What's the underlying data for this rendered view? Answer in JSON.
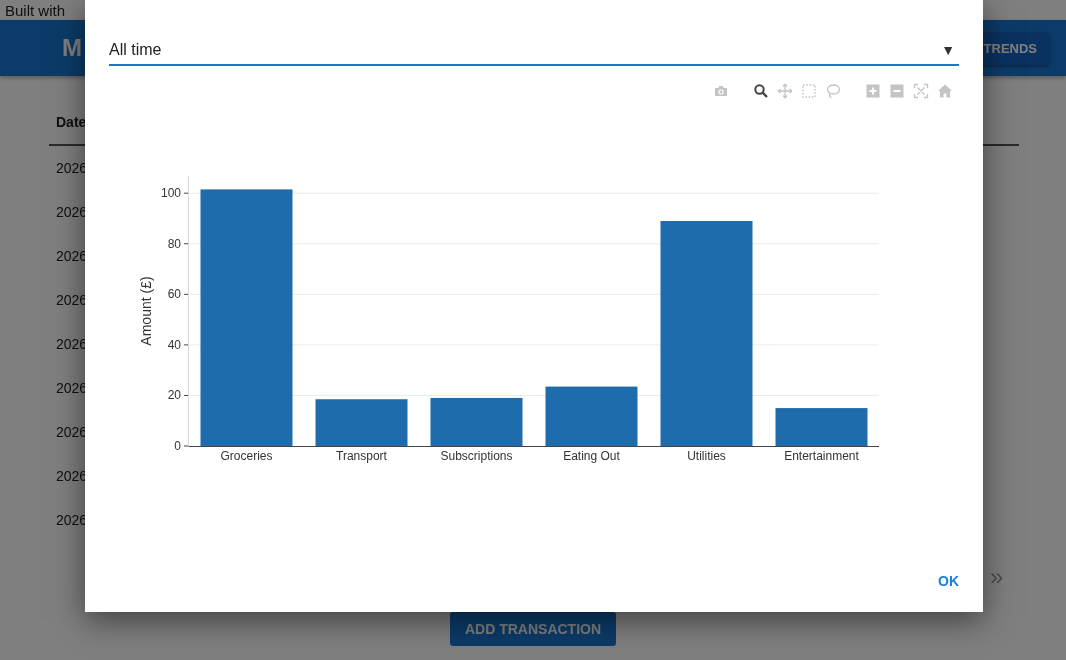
{
  "background": {
    "banner": "Built with",
    "header": {
      "title": "M",
      "trends_button": "TRENDS"
    },
    "table": {
      "columns": [
        "Date"
      ],
      "rows": [
        [
          "2026"
        ],
        [
          "2026"
        ],
        [
          "2026"
        ],
        [
          "2026"
        ],
        [
          "2026"
        ],
        [
          "2026"
        ],
        [
          "2026"
        ],
        [
          "2026"
        ],
        [
          "2026"
        ]
      ]
    },
    "pagination": {
      "next": "»"
    },
    "add_button": "ADD TRANSACTION"
  },
  "dialog": {
    "period_select": {
      "value": "All time",
      "caret": "▼"
    },
    "chart_data": {
      "type": "bar",
      "ylabel": "Amount (£)",
      "categories": [
        "Groceries",
        "Transport",
        "Subscriptions",
        "Eating Out",
        "Utilities",
        "Entertainment"
      ],
      "values": [
        101.5,
        18.5,
        19,
        23.5,
        89,
        15
      ],
      "ylim": [
        0,
        106.8
      ],
      "yticks": [
        0,
        20,
        40,
        60,
        80,
        100
      ],
      "grid": true
    },
    "ok_button": "OK"
  }
}
